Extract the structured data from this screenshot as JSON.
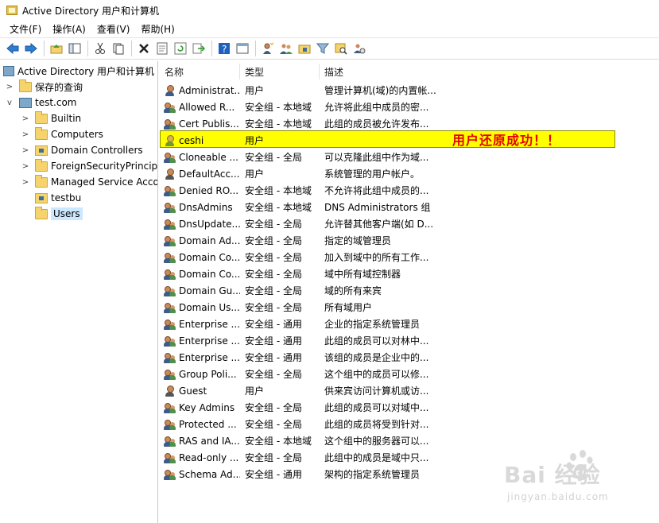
{
  "window": {
    "title": "Active Directory 用户和计算机"
  },
  "menu": [
    "文件(F)",
    "操作(A)",
    "查看(V)",
    "帮助(H)"
  ],
  "toolbar_icons": [
    "back-arrow-icon",
    "forward-arrow-icon",
    "up-folder-icon",
    "show-tree-icon",
    "cut-icon",
    "copy-icon",
    "delete-icon",
    "properties-icon",
    "refresh-icon",
    "export-icon",
    "help-icon",
    "console-icon",
    "new-user-icon",
    "new-group-icon",
    "new-ou-icon",
    "filter-icon",
    "find-icon",
    "delegate-icon"
  ],
  "tree": {
    "root": "Active Directory 用户和计算机",
    "saved_queries": "保存的查询",
    "domain": "test.com",
    "children": [
      "Builtin",
      "Computers",
      "Domain Controllers",
      "ForeignSecurityPrincipa",
      "Managed Service Acco",
      "testbu",
      "Users"
    ],
    "selected": "Users"
  },
  "columns": {
    "name": "名称",
    "type": "类型",
    "desc": "描述"
  },
  "rows": [
    {
      "name": "Administrat...",
      "type": "用户",
      "desc": "管理计算机(域)的内置帐...",
      "icon": "user"
    },
    {
      "name": "Allowed R...",
      "type": "安全组 - 本地域",
      "desc": "允许将此组中成员的密...",
      "icon": "group"
    },
    {
      "name": "Cert Publis...",
      "type": "安全组 - 本地域",
      "desc": "此组的成员被允许发布...",
      "icon": "group"
    },
    {
      "name": "ceshi",
      "type": "用户",
      "desc": "",
      "icon": "user"
    },
    {
      "name": "Cloneable ...",
      "type": "安全组 - 全局",
      "desc": "可以克隆此组中作为域...",
      "icon": "group"
    },
    {
      "name": "DefaultAcc...",
      "type": "用户",
      "desc": "系统管理的用户帐户。",
      "icon": "guest"
    },
    {
      "name": "Denied RO...",
      "type": "安全组 - 本地域",
      "desc": "不允许将此组中成员的...",
      "icon": "group"
    },
    {
      "name": "DnsAdmins",
      "type": "安全组 - 本地域",
      "desc": "DNS Administrators 组",
      "icon": "group"
    },
    {
      "name": "DnsUpdate...",
      "type": "安全组 - 全局",
      "desc": "允许替其他客户端(如 D...",
      "icon": "group"
    },
    {
      "name": "Domain Ad...",
      "type": "安全组 - 全局",
      "desc": "指定的域管理员",
      "icon": "group"
    },
    {
      "name": "Domain Co...",
      "type": "安全组 - 全局",
      "desc": "加入到域中的所有工作...",
      "icon": "group"
    },
    {
      "name": "Domain Co...",
      "type": "安全组 - 全局",
      "desc": "域中所有域控制器",
      "icon": "group"
    },
    {
      "name": "Domain Gu...",
      "type": "安全组 - 全局",
      "desc": "域的所有来宾",
      "icon": "group"
    },
    {
      "name": "Domain Us...",
      "type": "安全组 - 全局",
      "desc": "所有域用户",
      "icon": "group"
    },
    {
      "name": "Enterprise ...",
      "type": "安全组 - 通用",
      "desc": "企业的指定系统管理员",
      "icon": "group"
    },
    {
      "name": "Enterprise ...",
      "type": "安全组 - 通用",
      "desc": "此组的成员可以对林中...",
      "icon": "group"
    },
    {
      "name": "Enterprise ...",
      "type": "安全组 - 通用",
      "desc": "该组的成员是企业中的...",
      "icon": "group"
    },
    {
      "name": "Group Poli...",
      "type": "安全组 - 全局",
      "desc": "这个组中的成员可以修...",
      "icon": "group"
    },
    {
      "name": "Guest",
      "type": "用户",
      "desc": "供来宾访问计算机或访...",
      "icon": "guest"
    },
    {
      "name": "Key Admins",
      "type": "安全组 - 全局",
      "desc": "此组的成员可以对域中...",
      "icon": "group"
    },
    {
      "name": "Protected ...",
      "type": "安全组 - 全局",
      "desc": "此组的成员将受到针对...",
      "icon": "group"
    },
    {
      "name": "RAS and IA...",
      "type": "安全组 - 本地域",
      "desc": "这个组中的服务器可以...",
      "icon": "group"
    },
    {
      "name": "Read-only ...",
      "type": "安全组 - 全局",
      "desc": "此组中的成员是域中只...",
      "icon": "group"
    },
    {
      "name": "Schema Ad...",
      "type": "安全组 - 通用",
      "desc": "架构的指定系统管理员",
      "icon": "group"
    }
  ],
  "annotation": {
    "text": "用户还原成功！！"
  },
  "watermark": {
    "main": "Bai  经验",
    "sub": "jingyan.baidu.com"
  }
}
